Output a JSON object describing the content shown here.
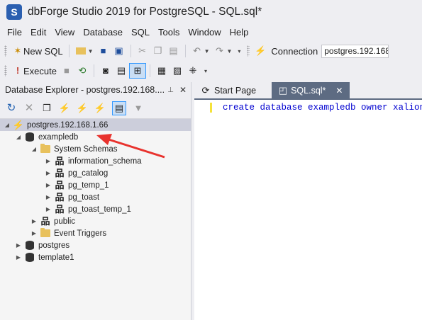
{
  "window": {
    "title": "dbForge Studio 2019 for PostgreSQL - SQL.sql*",
    "logo_letter": "S"
  },
  "menu": [
    "File",
    "Edit",
    "View",
    "Database",
    "SQL",
    "Tools",
    "Window",
    "Help"
  ],
  "toolbar1": {
    "new_sql_label": "New SQL",
    "connection_label": "Connection",
    "connection_value": "postgres.192.168"
  },
  "toolbar2": {
    "execute_label": "Execute"
  },
  "explorer": {
    "title": "Database Explorer - postgres.192.168....",
    "pin": "⊥",
    "close": "✕",
    "tree": {
      "server": "postgres.192.168.1.66",
      "db_example": "exampledb",
      "system_schemas": "System Schemas",
      "schemas": [
        "information_schema",
        "pg_catalog",
        "pg_temp_1",
        "pg_toast",
        "pg_toast_temp_1"
      ],
      "public": "public",
      "event_triggers": "Event Triggers",
      "db_postgres": "postgres",
      "db_template1": "template1"
    }
  },
  "tabs": {
    "start_page": "Start Page",
    "sql_tab": "SQL.sql*",
    "close": "✕"
  },
  "editor": {
    "code": "create database exampledb owner xalion;"
  },
  "colors": {
    "accent": "#5d6b82",
    "annotation_arrow": "#e8322d"
  }
}
